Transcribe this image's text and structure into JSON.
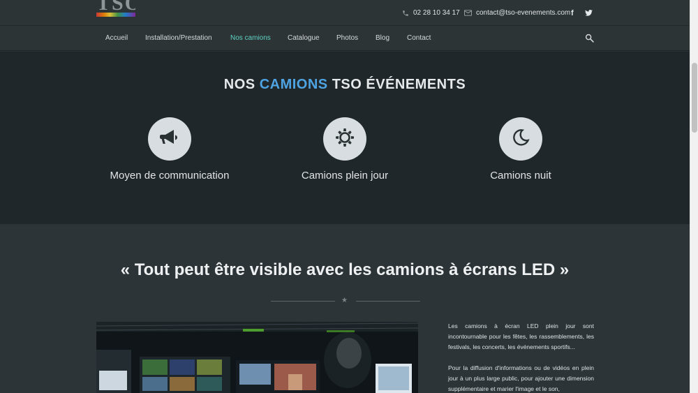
{
  "header": {
    "logo_text": "TSO",
    "phone": "02 28 10 34 17",
    "email": "contact@tso-evenements.com",
    "social": [
      "f",
      "twitter-icon"
    ]
  },
  "nav": {
    "items": [
      "Accueil",
      "Installation/Prestation",
      "Nos camions",
      "Catalogue",
      "Photos",
      "Blog",
      "Contact"
    ],
    "active": "Nos camions",
    "active_color": "#5fd2c3"
  },
  "section_trucks": {
    "title_part1": "NOS ",
    "title_accent": "CAMIONS",
    "title_part2": " TSO ÉVÉNEMENTS",
    "accent_color": "#4ea3e2",
    "features": [
      {
        "icon": "megaphone-icon",
        "label": "Moyen de communication"
      },
      {
        "icon": "sun-icon",
        "label": "Camions plein jour"
      },
      {
        "icon": "moon-icon",
        "label": "Camions nuit"
      }
    ]
  },
  "section_led": {
    "quote": "« Tout peut être visible avec les camions à écrans LED »",
    "divider_star": "★",
    "para1": "Les camions à écran LED plein jour sont incontournable pour les fêtes, les rassemblements, les festivals, les concerts, les événements sportifs...",
    "para2": "Pour la diffusion d'informations ou de vidéos en plein jour à un plus large public, pour ajouter une dimension supplémentaire et marier l'image et le son,"
  }
}
